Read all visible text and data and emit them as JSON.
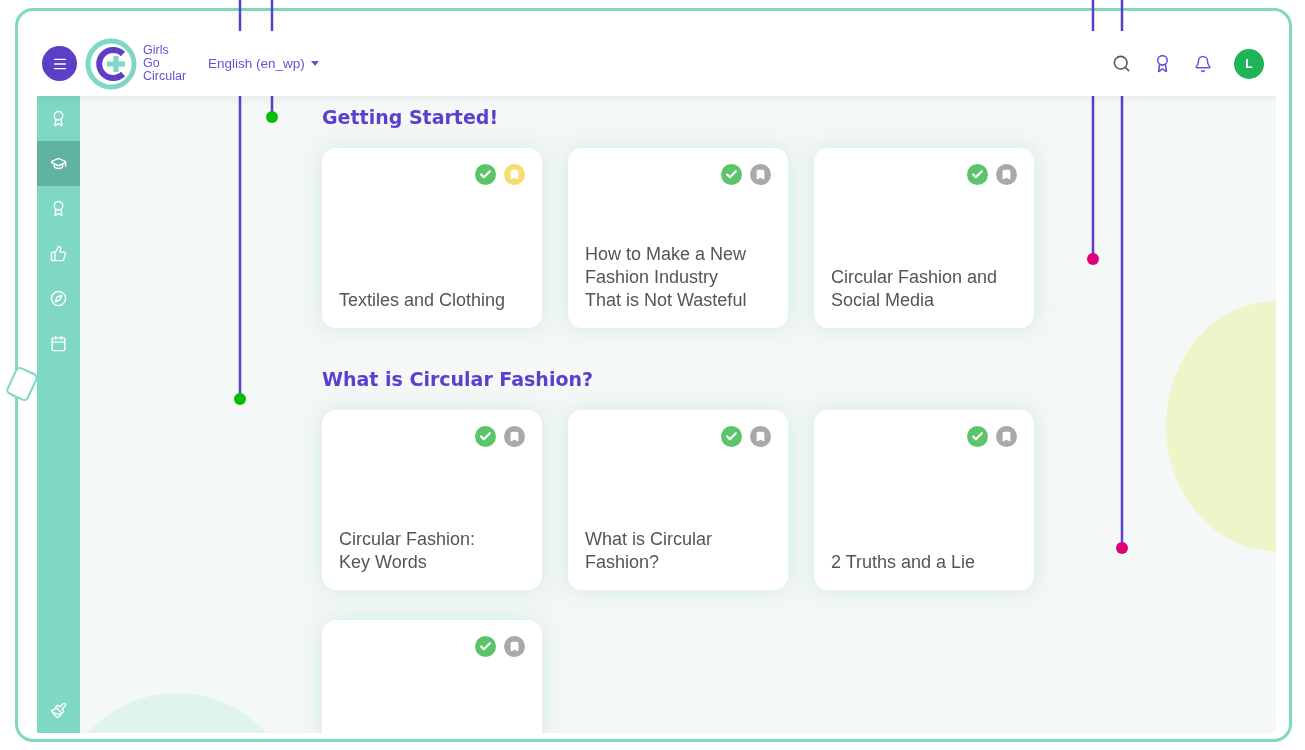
{
  "header": {
    "brand": [
      "Girls",
      "Go",
      "Circular"
    ],
    "language": "English (en_wp)",
    "avatar": "L"
  },
  "sidebar": {
    "items": [
      {
        "selected": false
      },
      {
        "selected": true
      },
      {
        "selected": false
      },
      {
        "selected": false
      },
      {
        "selected": false
      },
      {
        "selected": false
      }
    ]
  },
  "sections": [
    {
      "title": "Getting Started!",
      "cards": [
        {
          "title": "Textiles and Clothing",
          "completed": true,
          "bookmarked": true
        },
        {
          "title": "How to Make a New Fashion Industry That is Not Wasteful",
          "completed": true,
          "bookmarked": false
        },
        {
          "title": "Circular Fashion and Social Media",
          "completed": true,
          "bookmarked": false
        }
      ]
    },
    {
      "title": "What is Circular Fashion?",
      "cards": [
        {
          "title": "Circular Fashion: Key Words",
          "completed": true,
          "bookmarked": false
        },
        {
          "title": "What is Circular Fashion?",
          "completed": true,
          "bookmarked": false
        },
        {
          "title": "2 Truths and a Lie",
          "completed": true,
          "bookmarked": false
        },
        {
          "completed": true,
          "bookmarked": false
        }
      ]
    }
  ],
  "annotations": [
    {
      "color": "#00c000"
    },
    {
      "color": "#00c000"
    },
    {
      "color": "#e0007a"
    },
    {
      "color": "#e0007a"
    }
  ]
}
